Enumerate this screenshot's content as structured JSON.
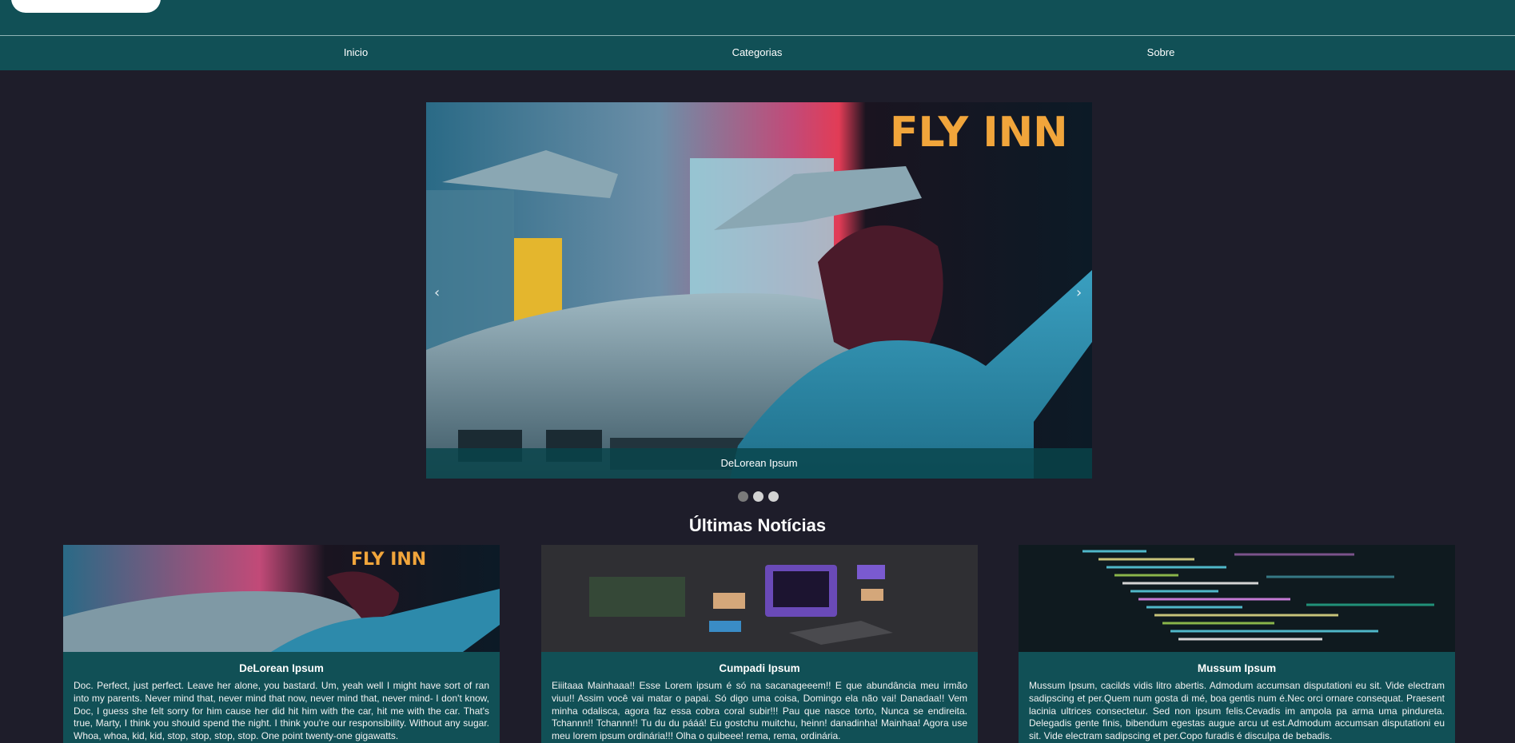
{
  "nav": {
    "items": [
      {
        "label": "Inicio"
      },
      {
        "label": "Categorias"
      },
      {
        "label": "Sobre"
      }
    ]
  },
  "carousel": {
    "caption": "DeLorean Ipsum",
    "prev_icon": "chevron-left-icon",
    "next_icon": "chevron-right-icon",
    "slide_count": 3,
    "active_index": 0
  },
  "news": {
    "title": "Últimas Notícias",
    "cards": [
      {
        "title": "DeLorean Ipsum",
        "text": "Doc. Perfect, just perfect. Leave her alone, you bastard. Um, yeah well I might have sort of ran into my parents. Never mind that, never mind that now, never mind that, never mind- I don't know, Doc, I guess she felt sorry for him cause her did hit him with the car, hit me with the car. That's true, Marty, I think you should spend the night. I think you're our responsibility. Without any sugar. Whoa, whoa, kid, kid, stop, stop, stop, stop. One point twenty-one gigawatts."
      },
      {
        "title": "Cumpadi Ipsum",
        "text": "Eiiitaaa Mainhaaa!! Esse Lorem ipsum é só na sacanageeem!! E que abundância meu irmão viuu!! Assim você vai matar o papai. Só digo uma coisa, Domingo ela não vai! Danadaa!! Vem minha odalisca, agora faz essa cobra coral subir!!! Pau que nasce torto, Nunca se endireita. Tchannn!! Tchannn!! Tu du du pááá! Eu gostchu muitchu, heinn! danadinha! Mainhaa! Agora use meu lorem ipsum ordinária!!! Olha o quibeee! rema, rema, ordinária."
      },
      {
        "title": "Mussum Ipsum",
        "text": "Mussum Ipsum, cacilds vidis litro abertis. Admodum accumsan disputationi eu sit. Vide electram sadipscing et per.Quem num gosta di mé, boa gentis num é.Nec orci ornare consequat. Praesent lacinia ultrices consectetur. Sed non ipsum felis.Cevadis im ampola pa arma uma pindureta. Delegadis gente finis, bibendum egestas augue arcu ut est.Admodum accumsan disputationi eu sit. Vide electram sadipscing et per.Copo furadis é disculpa de bebadis."
      }
    ]
  }
}
